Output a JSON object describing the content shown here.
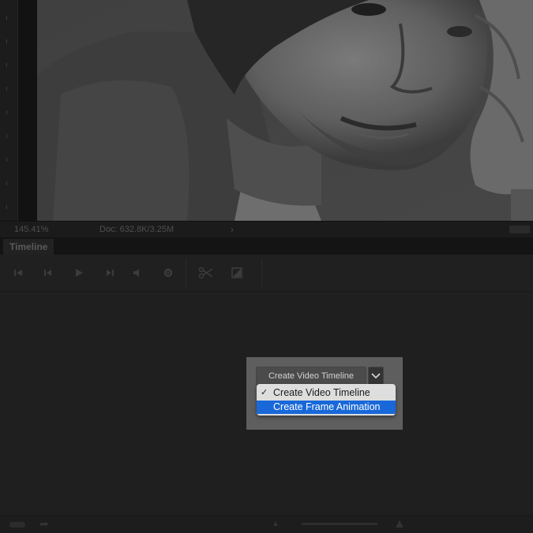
{
  "canvas": {
    "photo_description_icon": "portrait-photo"
  },
  "status_bar": {
    "zoom": "145.41%",
    "doc_info": "Doc: 632.8K/3.25M",
    "arrow_glyph": "›"
  },
  "timeline_panel": {
    "tab_label": "Timeline",
    "toolbar_icons": [
      "go-to-first-frame-icon",
      "previous-frame-icon",
      "play-icon",
      "next-frame-icon",
      "audio-icon",
      "settings-icon",
      "split-at-playhead-icon",
      "transition-icon"
    ]
  },
  "create_timeline": {
    "button_label": "Create Video Timeline",
    "menu_items": [
      {
        "label": "Create Video Timeline",
        "checked": true,
        "check_glyph": "✓"
      },
      {
        "label": "Create Frame Animation",
        "highlighted": true
      }
    ]
  },
  "colors": {
    "menu_highlight": "#1868d9",
    "panel_background": "#1f1f1f",
    "overlay_box": "#5e5e5e"
  }
}
